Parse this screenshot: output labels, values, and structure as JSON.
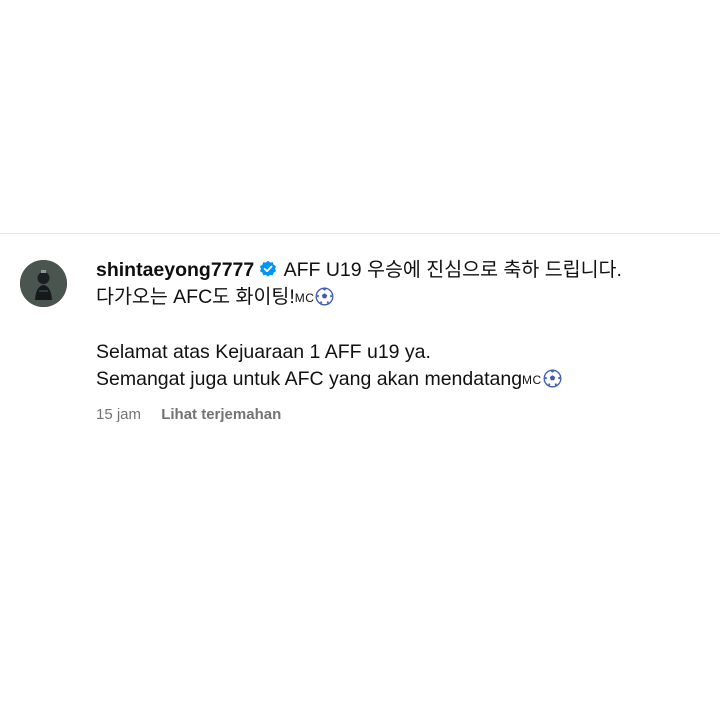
{
  "comment": {
    "username": "shintaeyong7777",
    "verified_icon": "verified-badge-icon",
    "text_line_1": "AFF U19 우승에 진심으로 축하 드립니다.",
    "text_line_2": "다가오는 AFC도 화이팅!",
    "mc_1": "MC",
    "text_line_3": "Selamat atas Kejuaraan 1 AFF u19 ya.",
    "text_line_4": "Semangat juga untuk AFC yang akan mendatang",
    "mc_2": "MC",
    "emoji_icon": "soccer-ball-icon",
    "time": "15 jam",
    "translate_label": "Lihat terjemahan"
  },
  "colors": {
    "verified": "#0095f6",
    "meta_text": "#737373",
    "divider": "#e6e6e6"
  }
}
